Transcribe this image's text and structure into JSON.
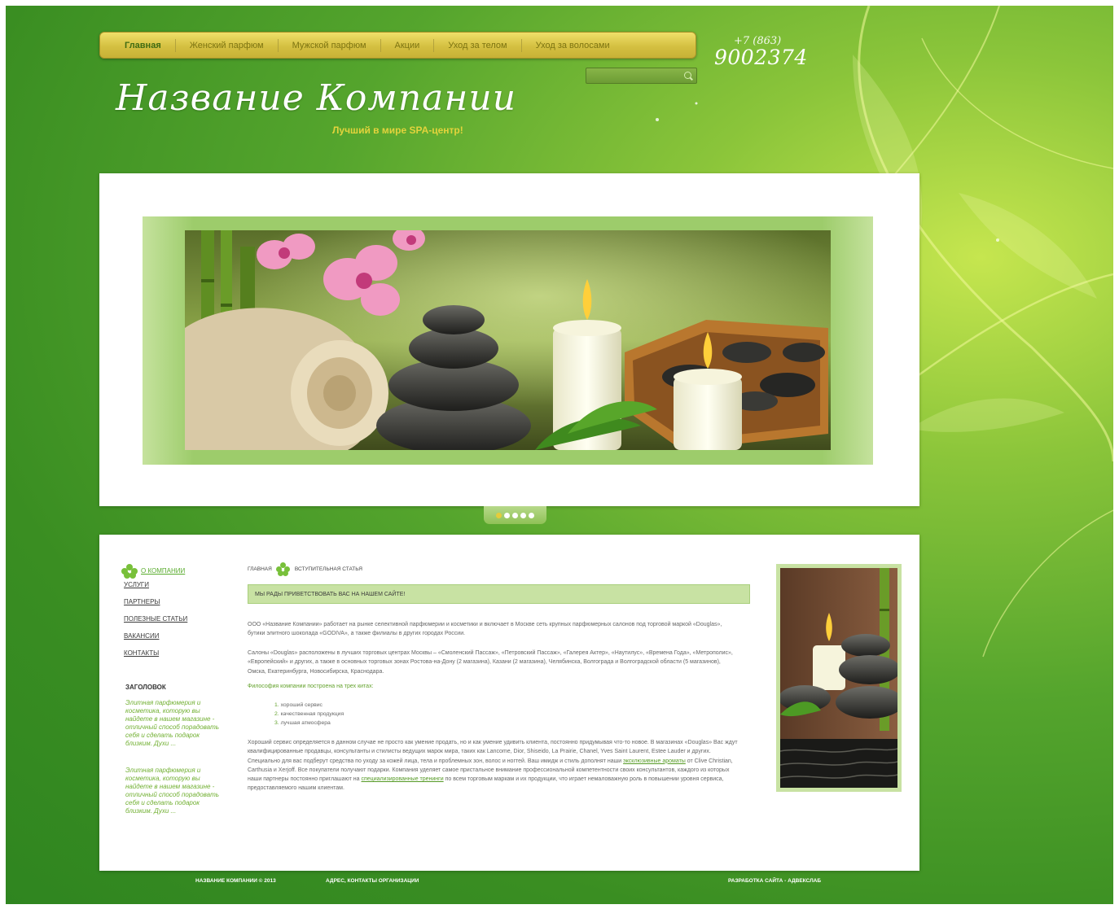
{
  "nav": {
    "items": [
      {
        "label": "Главная",
        "active": true
      },
      {
        "label": "Женский парфюм",
        "active": false
      },
      {
        "label": "Мужской парфюм",
        "active": false
      },
      {
        "label": "Акции",
        "active": false
      },
      {
        "label": "Уход за телом",
        "active": false
      },
      {
        "label": "Уход за волосами",
        "active": false
      }
    ]
  },
  "phone": {
    "code": "+7 (863)",
    "number": "9002374"
  },
  "search": {
    "placeholder": "",
    "icon": "search-icon"
  },
  "logo": {
    "script_text": "Название Компании",
    "slogan": "Лучший в мире SPA-центр!"
  },
  "slider": {
    "dot_count": 5,
    "active_dot": 1
  },
  "sidebar": {
    "items": [
      "О КОМПАНИИ",
      "УСЛУГИ",
      "ПАРТНЕРЫ",
      "ПОЛЕЗНЫЕ СТАТЬИ",
      "ВАКАНСИИ",
      "КОНТАКТЫ"
    ],
    "heading": "ЗАГОЛОВОК",
    "text1": "Элитная парфюмерия и косметика, которую вы найдете в нашем магазине - отличный способ порадовать себя и сделать подарок близким. Духи ...",
    "text2": "Элитная парфюмерия и косметика, которую вы найдете в нашем магазине - отличный способ порадовать себя и сделать подарок близким. Духи ..."
  },
  "breadcrumb": {
    "home": "ГЛАВНАЯ",
    "current": "ВСТУПИТЕЛЬНАЯ СТАТЬЯ"
  },
  "article": {
    "welcome": "МЫ РАДЫ ПРИВЕТСТВОВАТЬ ВАС НА НАШЕМ САЙТЕ!",
    "p1": "ООО «Название Компании» работает на рынке селективной парфюмерии и косметики и включает в Москве сеть крупных парфюмерных салонов под торговой маркой «Douglas», бутики элитного шоколада «GODIVA», а также филиалы в других городах России.",
    "p2": "Салоны «Douglas» расположены в лучших торговых центрах Москвы – «Смоленский Пассаж», «Петровский Пассаж», «Галерея Актер», «Наутилус», «Времена Года», «Метрополис», «Европейский» и других, а также в основных торговых зонах Ростова-на-Дону (2 магазина), Казани (2 магазина), Челябинска, Волгограда и Волгоградской области (5 магазинов), Омска, Екатеринбурга, Новосибирска, Краснодара.",
    "philosophy": "Философия компании построена на трех китах:",
    "list": [
      "хороший сервис",
      "качественная продукция",
      "лучшая атмосфера"
    ],
    "p3_a": "Хороший сервис определяется в данном случае не просто как умение продать, но и как умение удивить клиента, постоянно придумывая что-то новое. В магазинах «Douglas» Вас ждут квалифицированные продавцы, консультанты и стилисты ведущих марок мира, таких как Lancome, Dior, Shiseido, La Prairie, Chanel, Yves Saint Laurent, Estee Lauder и других. Специально для вас подберут средства по уходу за кожей лица, тела и проблемных зон, волос и ногтей. Ваш имидж и стиль дополнят наши",
    "link1": "эксклюзивные ароматы",
    "p3_b": "от Clive Christian, Carthusia и Xerjoff. Все покупатели получают подарки. Компания уделяет самое пристальное внимание профессиональной компетентности своих консультантов, каждого из которых наши партнеры постоянно приглашают на",
    "link2": "специализированные тренинги",
    "p3_c": "по всем торговым маркам и их продукции, что играет немаловажную роль в повышении уровня сервиса, предоставляемого нашим клиентам."
  },
  "footer": {
    "copyright": "НАЗВАНИЕ КОМПАНИИ © 2013",
    "address": "АДРЕС, КОНТАКТЫ ОРГАНИЗАЦИИ",
    "dev": "РАЗРАБОТКА САЙТА - АДВЕКСЛАБ"
  },
  "colors": {
    "brand_green": "#3a8e22",
    "nav_gold": "#d4c041",
    "accent_green": "#63a22c",
    "slogan": "#e3d33c"
  }
}
